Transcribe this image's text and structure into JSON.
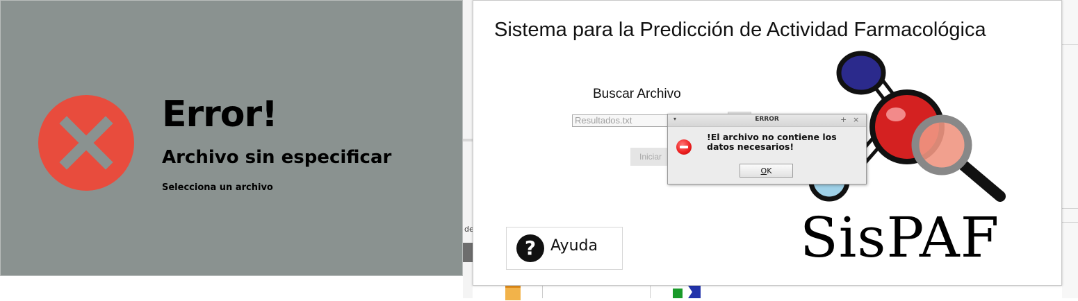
{
  "error_panel": {
    "title": "Error!",
    "subtitle": "Archivo sin especificar",
    "detail": "Selecciona un archivo",
    "colors": {
      "background": "#8a9290",
      "icon": "#e84c3d",
      "cross": "#8a9290"
    }
  },
  "app": {
    "title": "Sistema para la Predicción de Actividad Farmacológica",
    "search_label": "Buscar Archivo",
    "file_input_value": "Resultados.txt",
    "start_button_label": "Iniciar",
    "help_button_label": "Ayuda",
    "logo_text": "SisPAF"
  },
  "dialog": {
    "title": "ERROR",
    "message": "!El archivo no contiene los datos necesarios!",
    "ok_label": "OK",
    "menu_glyph": "▾",
    "max_glyph": "+",
    "close_glyph": "×"
  },
  "background": {
    "partial_text": "de"
  },
  "icons": {
    "error": "error-x-icon",
    "help": "question-icon",
    "dialog_error": "stop-icon",
    "logo": "molecule-magnifier-icon"
  }
}
